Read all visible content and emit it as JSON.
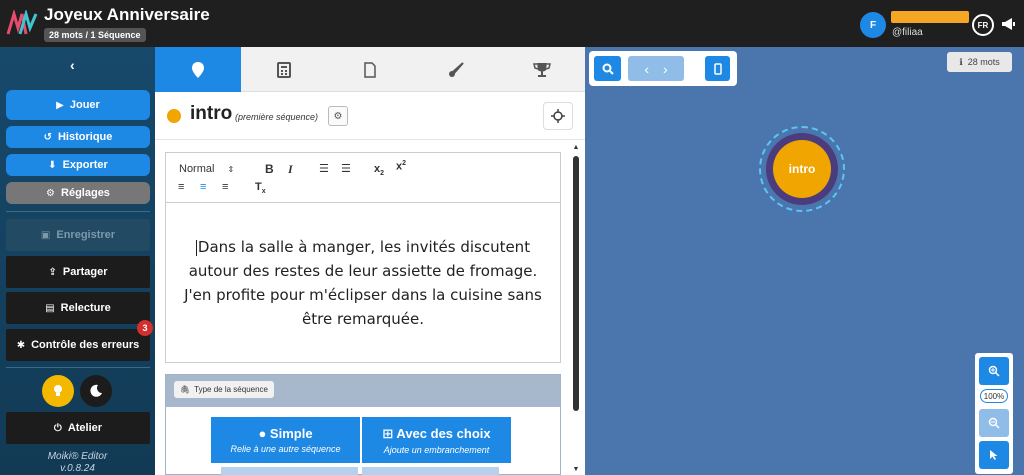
{
  "header": {
    "title": "Joyeux Anniversaire",
    "subtitle": "28 mots / 1 Séquence",
    "user_initial": "F",
    "user_handle": "@filiaa",
    "language": "FR"
  },
  "sidebar": {
    "play_label": "Jouer",
    "history_label": "Historique",
    "export_label": "Exporter",
    "settings_label": "Réglages",
    "save_label": "Enregistrer",
    "share_label": "Partager",
    "review_label": "Relecture",
    "errors_label": "Contrôle des erreurs",
    "errors_count": "3",
    "workshop_label": "Atelier",
    "version_line1": "Moiki® Editor",
    "version_line2": "v.0.8.24"
  },
  "editor": {
    "tabs": [
      "location",
      "calculator",
      "document",
      "brush",
      "trophy"
    ],
    "sequence_name": "intro",
    "sequence_note": "(première séquence)",
    "format_select": "Normal",
    "text": "Dans la salle à manger, les invités discutent autour des restes de leur assiette de fromage. J'en profite pour m'éclipser dans la cuisine sans être remarquée.",
    "type_label": "Type de la séquence",
    "type_simple_title": "Simple",
    "type_simple_sub": "Relie à une autre séquence",
    "type_choices_title": "Avec des choix",
    "type_choices_sub": "Ajoute un embranchement"
  },
  "canvas": {
    "words": "28 mots",
    "node_label": "intro",
    "zoom": "100%"
  },
  "colors": {
    "accent": "#1e88e5",
    "node": "#f0a500",
    "canvas_bg": "#4a76ad",
    "sidebar_bg": "#17496b"
  }
}
